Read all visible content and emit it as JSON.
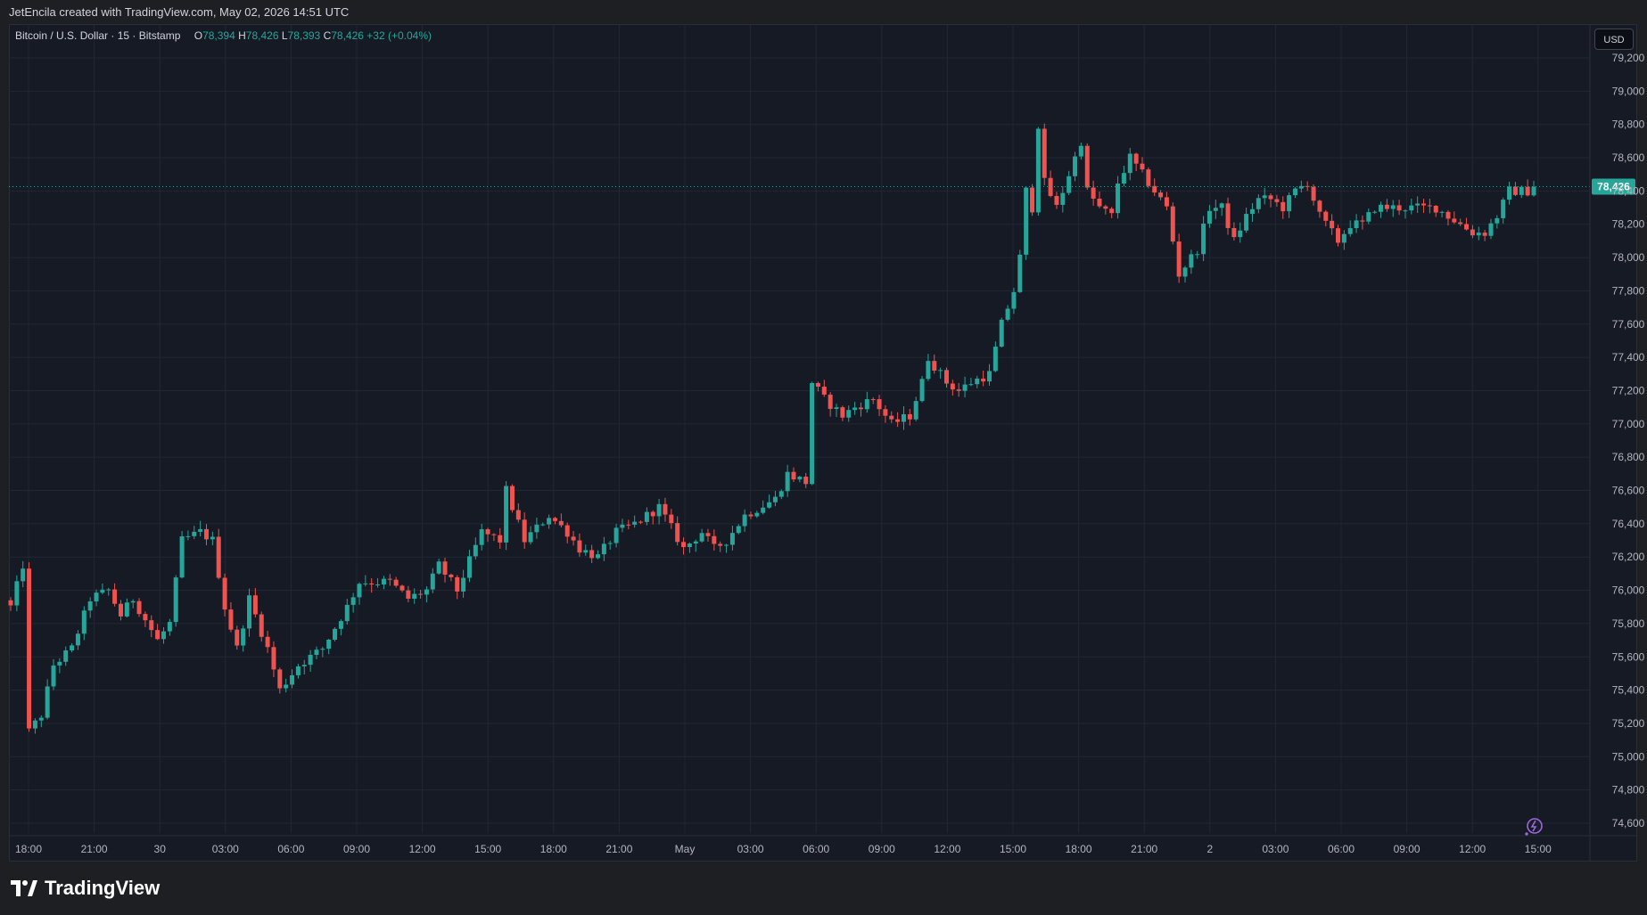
{
  "header": {
    "attribution": "JetEncila created with TradingView.com, May 02, 2026 14:51 UTC"
  },
  "legend": {
    "symbol": "Bitcoin / U.S. Dollar · 15 · Bitstamp",
    "open_label": "O",
    "open": "78,394",
    "high_label": "H",
    "high": "78,426",
    "low_label": "L",
    "low": "78,393",
    "close_label": "C",
    "close": "78,426",
    "change": "+32 (+0.04%)"
  },
  "currency_button": "USD",
  "current_price_label": "78,426",
  "brand": "TradingView",
  "colors": {
    "up": "#26a69a",
    "down": "#ef5350",
    "background": "#161a25",
    "grid": "#232734",
    "text": "#d1d4dc"
  },
  "chart_data": {
    "type": "candlestick",
    "ylim": [
      74500,
      79300
    ],
    "y_ticks": [
      "79,200",
      "79,000",
      "78,800",
      "78,600",
      "78,400",
      "78,200",
      "78,000",
      "77,800",
      "77,600",
      "77,400",
      "77,200",
      "77,000",
      "76,800",
      "76,600",
      "76,400",
      "76,200",
      "76,000",
      "75,800",
      "75,600",
      "75,400",
      "75,200",
      "75,000",
      "74,800",
      "74,600"
    ],
    "y_tick_values": [
      79200,
      79000,
      78800,
      78600,
      78400,
      78200,
      78000,
      77800,
      77600,
      77400,
      77200,
      77000,
      76800,
      76600,
      76400,
      76200,
      76000,
      75800,
      75600,
      75400,
      75200,
      75000,
      74800,
      74600
    ],
    "x_ticks": [
      "18:00",
      "21:00",
      "30",
      "03:00",
      "06:00",
      "09:00",
      "12:00",
      "15:00",
      "18:00",
      "21:00",
      "May",
      "03:00",
      "06:00",
      "09:00",
      "12:00",
      "15:00",
      "18:00",
      "21:00",
      "2",
      "03:00",
      "06:00",
      "09:00",
      "12:00",
      "15:00"
    ],
    "current_price": 78426,
    "anchors": [
      [
        0,
        75900
      ],
      [
        2,
        76150
      ],
      [
        3,
        75150
      ],
      [
        5,
        75250
      ],
      [
        7,
        75550
      ],
      [
        10,
        75650
      ],
      [
        13,
        75950
      ],
      [
        16,
        76000
      ],
      [
        18,
        75850
      ],
      [
        20,
        75950
      ],
      [
        24,
        75700
      ],
      [
        26,
        75800
      ],
      [
        28,
        76300
      ],
      [
        31,
        76350
      ],
      [
        33,
        76300
      ],
      [
        35,
        75900
      ],
      [
        37,
        75650
      ],
      [
        39,
        75950
      ],
      [
        42,
        75650
      ],
      [
        44,
        75400
      ],
      [
        47,
        75550
      ],
      [
        51,
        75650
      ],
      [
        55,
        75900
      ],
      [
        57,
        76050
      ],
      [
        62,
        76050
      ],
      [
        65,
        75950
      ],
      [
        68,
        76000
      ],
      [
        70,
        76150
      ],
      [
        73,
        76000
      ],
      [
        77,
        76350
      ],
      [
        80,
        76300
      ],
      [
        81,
        76600
      ],
      [
        84,
        76300
      ],
      [
        88,
        76450
      ],
      [
        91,
        76350
      ],
      [
        93,
        76250
      ],
      [
        96,
        76200
      ],
      [
        99,
        76350
      ],
      [
        102,
        76400
      ],
      [
        106,
        76500
      ],
      [
        110,
        76250
      ],
      [
        113,
        76350
      ],
      [
        115,
        76250
      ],
      [
        117,
        76300
      ],
      [
        120,
        76450
      ],
      [
        125,
        76550
      ],
      [
        127,
        76700
      ],
      [
        130,
        76650
      ],
      [
        131,
        77250
      ],
      [
        133,
        77150
      ],
      [
        136,
        77050
      ],
      [
        138,
        77100
      ],
      [
        141,
        77150
      ],
      [
        144,
        77000
      ],
      [
        147,
        77050
      ],
      [
        149,
        77250
      ],
      [
        150,
        77400
      ],
      [
        153,
        77250
      ],
      [
        155,
        77200
      ],
      [
        157,
        77250
      ],
      [
        160,
        77300
      ],
      [
        162,
        77600
      ],
      [
        164,
        77800
      ],
      [
        165,
        78000
      ],
      [
        166,
        78400
      ],
      [
        167,
        78300
      ],
      [
        168,
        78800
      ],
      [
        169,
        78450
      ],
      [
        171,
        78300
      ],
      [
        173,
        78500
      ],
      [
        175,
        78700
      ],
      [
        176,
        78400
      ],
      [
        178,
        78300
      ],
      [
        180,
        78250
      ],
      [
        181,
        78450
      ],
      [
        183,
        78600
      ],
      [
        185,
        78500
      ],
      [
        187,
        78400
      ],
      [
        189,
        78300
      ],
      [
        190,
        78100
      ],
      [
        191,
        77900
      ],
      [
        194,
        78050
      ],
      [
        196,
        78300
      ],
      [
        198,
        78300
      ],
      [
        200,
        78100
      ],
      [
        202,
        78250
      ],
      [
        204,
        78350
      ],
      [
        206,
        78350
      ],
      [
        208,
        78300
      ],
      [
        210,
        78400
      ],
      [
        212,
        78450
      ],
      [
        214,
        78250
      ],
      [
        216,
        78150
      ],
      [
        217,
        78100
      ],
      [
        219,
        78200
      ],
      [
        221,
        78200
      ],
      [
        223,
        78300
      ],
      [
        226,
        78300
      ],
      [
        229,
        78300
      ],
      [
        231,
        78300
      ],
      [
        233,
        78300
      ],
      [
        235,
        78250
      ],
      [
        237,
        78200
      ],
      [
        239,
        78150
      ],
      [
        241,
        78150
      ],
      [
        243,
        78250
      ],
      [
        245,
        78400
      ],
      [
        248,
        78400
      ],
      [
        249,
        78426
      ]
    ]
  }
}
